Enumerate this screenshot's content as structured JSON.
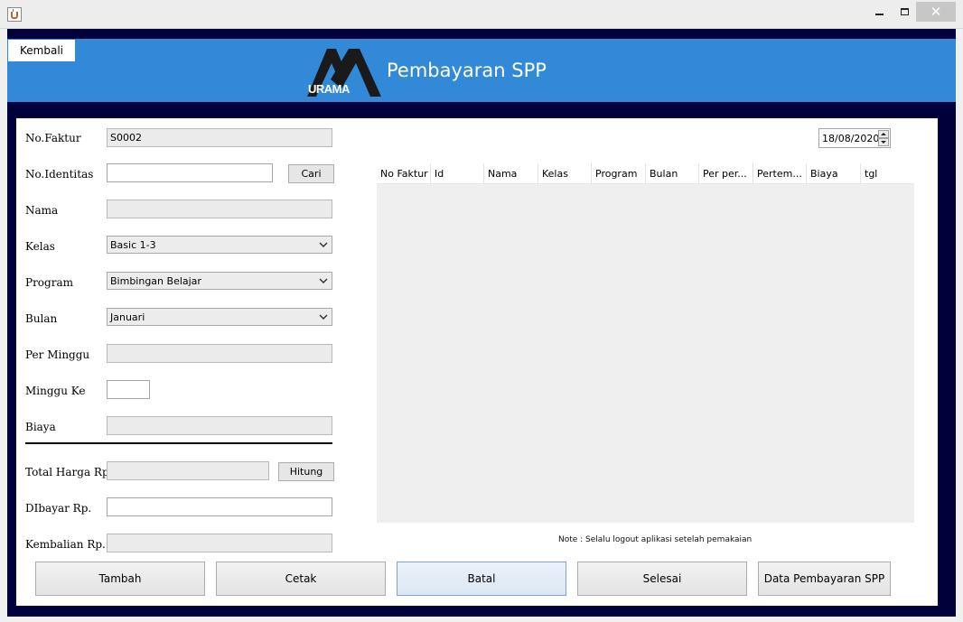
{
  "window": {
    "controls": {
      "minimize": "minimize-icon",
      "maximize": "maximize-icon",
      "close": "close-icon"
    }
  },
  "header": {
    "back_label": "Kembali",
    "logo_text": "URAMA",
    "title": "Pembayaran SPP"
  },
  "form": {
    "no_faktur": {
      "label": "No.Faktur",
      "value": "S0002"
    },
    "no_identitas": {
      "label": "No.Identitas",
      "value": ""
    },
    "cari_label": "Cari",
    "nama": {
      "label": "Nama",
      "value": ""
    },
    "kelas": {
      "label": "Kelas",
      "selected": "Basic 1-3"
    },
    "program": {
      "label": "Program",
      "selected": "Bimbingan Belajar"
    },
    "bulan": {
      "label": "Bulan",
      "selected": "Januari"
    },
    "per_minggu": {
      "label": "Per Minggu",
      "value": ""
    },
    "minggu_ke": {
      "label": "Minggu Ke",
      "value": ""
    },
    "biaya": {
      "label": "Biaya",
      "value": ""
    },
    "total_harga": {
      "label": "Total Harga Rp.",
      "value": ""
    },
    "hitung_label": "Hitung",
    "dibayar": {
      "label": "DIbayar  Rp.",
      "value": ""
    },
    "kembalian": {
      "label": "Kembalian  Rp.",
      "value": ""
    }
  },
  "date": "18/08/2020",
  "table": {
    "columns": [
      "No Faktur",
      "Id",
      "Nama",
      "Kelas",
      "Program",
      "Bulan",
      "Per per...",
      "Pertem...",
      "Biaya",
      "tgl"
    ],
    "rows": []
  },
  "note": "Note : Selalu logout aplikasi setelah pemakaian",
  "buttons": {
    "tambah": "Tambah",
    "cetak": "Cetak",
    "batal": "Batal",
    "selesai": "Selesai",
    "data_pembayaran": "Data Pembayaran SPP"
  },
  "colors": {
    "header_blue": "#3189d8",
    "frame_navy": "#00003a",
    "panel": "#ffffff"
  }
}
